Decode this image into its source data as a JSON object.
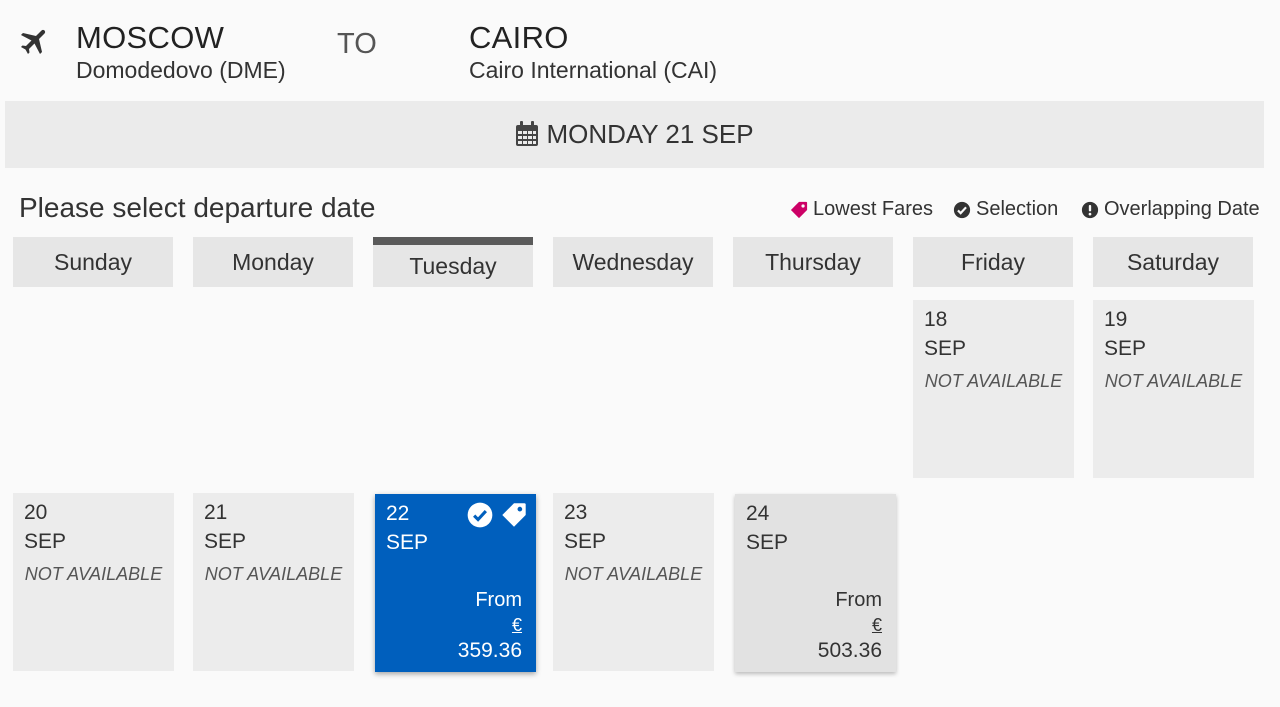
{
  "route": {
    "origin_city": "MOSCOW",
    "origin_airport": "Domodedovo (DME)",
    "connector": "TO",
    "destination_city": "CAIRO",
    "destination_airport": "Cairo International (CAI)"
  },
  "selected_date": "MONDAY 21 SEP",
  "prompt": "Please select departure date",
  "legend": {
    "lowest_fares": "Lowest Fares",
    "selection": "Selection",
    "overlapping": "Overlapping Date",
    "lowest_fares_color": "#cc0066"
  },
  "weekdays": [
    "Sunday",
    "Monday",
    "Tuesday",
    "Wednesday",
    "Thursday",
    "Friday",
    "Saturday"
  ],
  "calendar": {
    "fri18": {
      "day": "18",
      "month": "SEP",
      "status": "NOT AVAILABLE"
    },
    "sat19": {
      "day": "19",
      "month": "SEP",
      "status": "NOT AVAILABLE"
    },
    "sun20": {
      "day": "20",
      "month": "SEP",
      "status": "NOT AVAILABLE"
    },
    "mon21": {
      "day": "21",
      "month": "SEP",
      "status": "NOT AVAILABLE"
    },
    "tue22": {
      "day": "22",
      "month": "SEP",
      "from": "From",
      "currency": "€",
      "price": "359.36"
    },
    "wed23": {
      "day": "23",
      "month": "SEP",
      "status": "NOT AVAILABLE"
    },
    "thu24": {
      "day": "24",
      "month": "SEP",
      "from": "From",
      "currency": "€",
      "price": "503.36"
    }
  },
  "colors": {
    "selected": "#005fbd",
    "header_bg": "#ebebeb"
  }
}
